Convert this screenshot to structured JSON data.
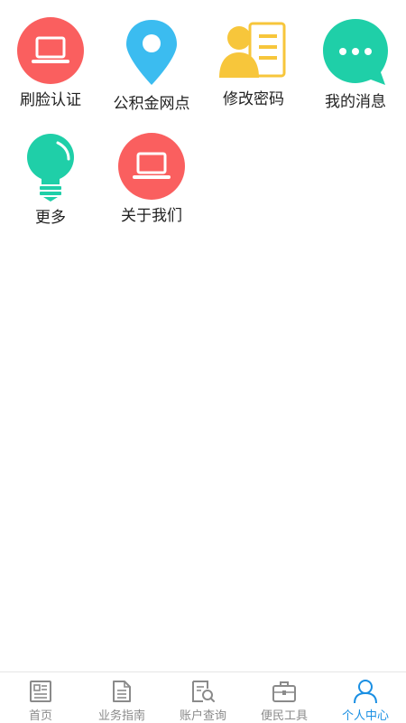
{
  "grid": {
    "items": [
      {
        "label": "刷脸认证",
        "icon": "laptop-icon",
        "color": "#fa5f5f"
      },
      {
        "label": "公积金网点",
        "icon": "location-pin-icon",
        "color": "#3bbcf0"
      },
      {
        "label": "修改密码",
        "icon": "user-card-icon",
        "color": "#f7c63b"
      },
      {
        "label": "我的消息",
        "icon": "chat-bubble-icon",
        "color": "#1fcfa8"
      },
      {
        "label": "更多",
        "icon": "lightbulb-icon",
        "color": "#1fcfa8"
      },
      {
        "label": "关于我们",
        "icon": "laptop-icon",
        "color": "#fa5f5f"
      }
    ]
  },
  "tabbar": {
    "tabs": [
      {
        "label": "首页",
        "icon": "newspaper-icon",
        "active": false
      },
      {
        "label": "业务指南",
        "icon": "document-icon",
        "active": false
      },
      {
        "label": "账户查询",
        "icon": "search-document-icon",
        "active": false
      },
      {
        "label": "便民工具",
        "icon": "toolbox-icon",
        "active": false
      },
      {
        "label": "个人中心",
        "icon": "user-icon",
        "active": true
      }
    ],
    "active_color": "#1a8fe3",
    "inactive_color": "#8a8a8a"
  }
}
